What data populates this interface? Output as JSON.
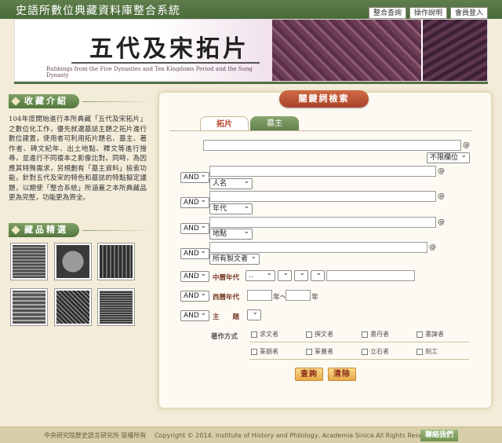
{
  "header": {
    "site_title": "史語所數位典藏資料庫整合系統",
    "nav": [
      "整合查詢",
      "操作說明",
      "會員登入"
    ]
  },
  "banner": {
    "title": "五代及宋拓片",
    "subtitle": "Rubbings from the Five Dynasties and Ten Kingdoms Period and the Song Dynasty"
  },
  "sidebar": {
    "about_title": "收藏介紹",
    "about_text": "104年度開始進行本所典藏「五代及宋拓片」之數位化工作，優先就選墓誌主題之拓片進行數位建置，使用者可利用拓片題名、墓主、著作者、碑文紀年、出土地點、釋文等進行搜尋，並進行不同複本之影像比對。同時，為因應其特殊需求，另規劃有「墓主資料」檢索功能，針對五代及宋的特色和墓誌的特點擬定議題，以期使「整合系統」所涵蓋之本所典藏品更為完整，功能更為齊全。",
    "gallery_title": "藏品精選"
  },
  "search": {
    "panel_title": "關鍵詞檢索",
    "tabs": [
      "拓片",
      "墓主"
    ],
    "at_symbol": "@",
    "field_all_select": "不限欄位",
    "rows": [
      {
        "op": "AND",
        "field": "人名"
      },
      {
        "op": "AND",
        "field": "年代"
      },
      {
        "op": "AND",
        "field": "地點"
      },
      {
        "op": "AND",
        "field": "所有製文者"
      }
    ],
    "chinese_era": {
      "op": "AND",
      "label": "中曆年代",
      "first_select": ".."
    },
    "western_era": {
      "op": "AND",
      "label": "西曆年代",
      "from_suffix": "年～",
      "to_suffix": "年"
    },
    "subject": {
      "op": "AND",
      "label": "主　　題"
    },
    "authorship": {
      "label": "著作方式",
      "options": [
        "求文者",
        "撰文者",
        "書丹者",
        "書諱者",
        "篆額者",
        "篆蓋者",
        "立石者",
        "刻工"
      ]
    },
    "buttons": {
      "search": "查詢",
      "clear": "清除"
    }
  },
  "footer": {
    "institute": "中央研究院歷史語言研究所 版權所有",
    "copyright": "Copyright © 2014. Institute of History and Philology, Academia Sinica  All Rights Reserved.",
    "contact": "聯絡我們"
  }
}
